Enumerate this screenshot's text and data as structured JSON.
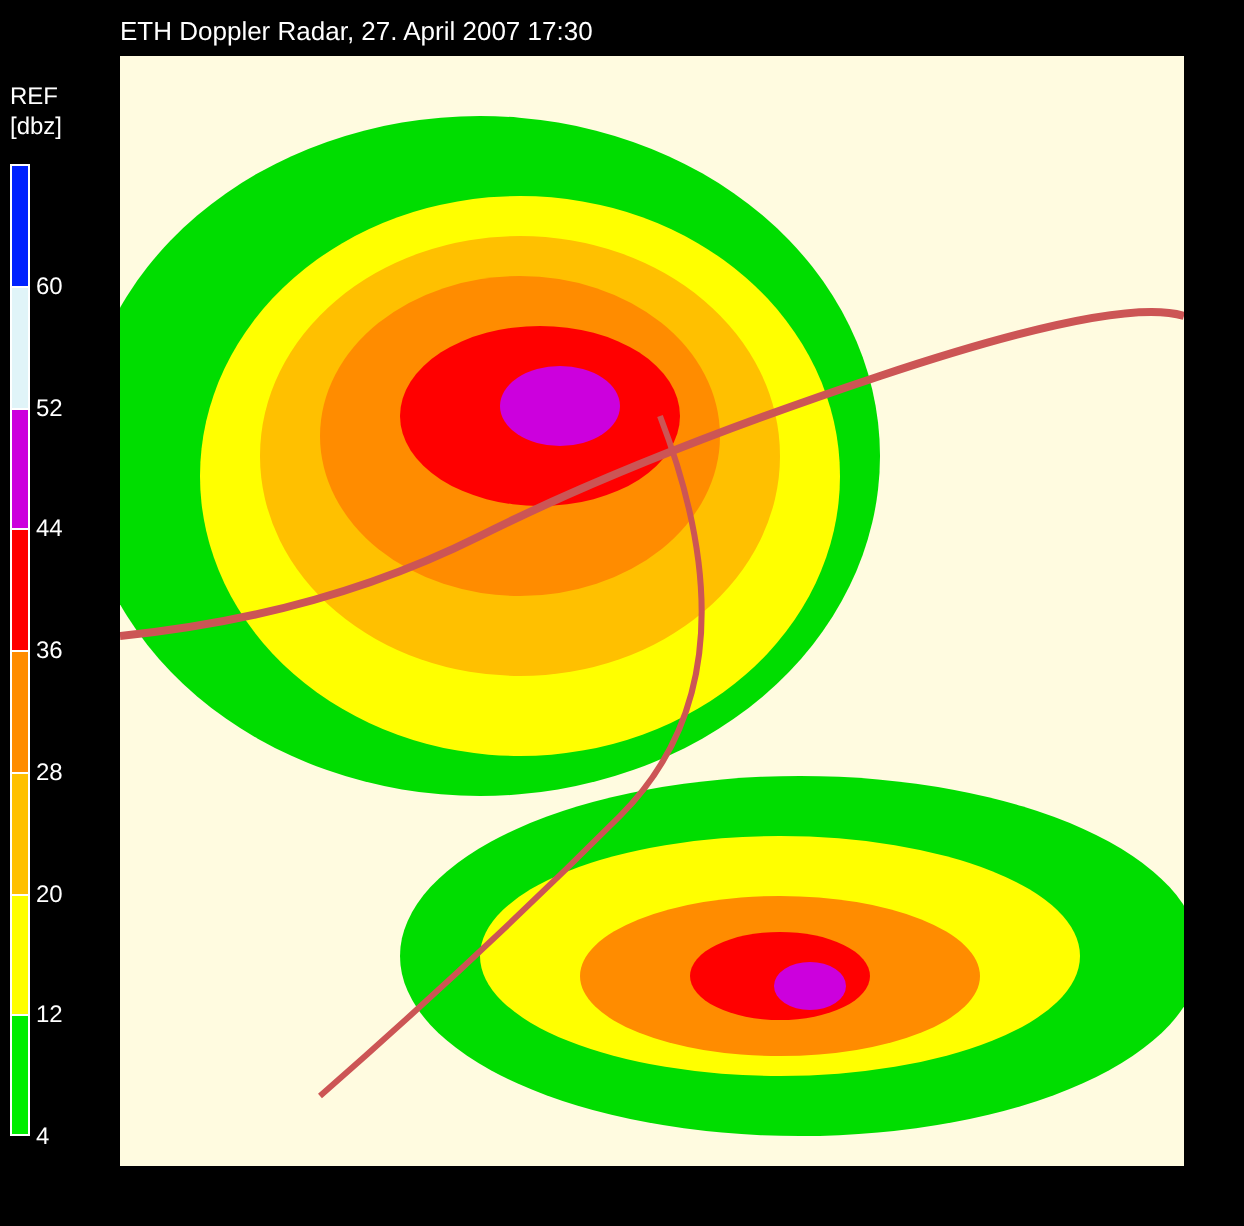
{
  "title": "ETH Doppler Radar, 27. April 2007 17:30",
  "legend": {
    "title": "REF",
    "unit": "[dbz]",
    "bands": [
      {
        "color": "#0022ff",
        "label": "60"
      },
      {
        "color": "#e0f4f8",
        "label": "52"
      },
      {
        "color": "#cc00dd",
        "label": "44"
      },
      {
        "color": "#ff0000",
        "label": "36"
      },
      {
        "color": "#ff8c00",
        "label": "28"
      },
      {
        "color": "#ffc000",
        "label": "20"
      },
      {
        "color": "#ffff00",
        "label": "12"
      },
      {
        "color": "#00ee00",
        "label": "4"
      }
    ]
  }
}
